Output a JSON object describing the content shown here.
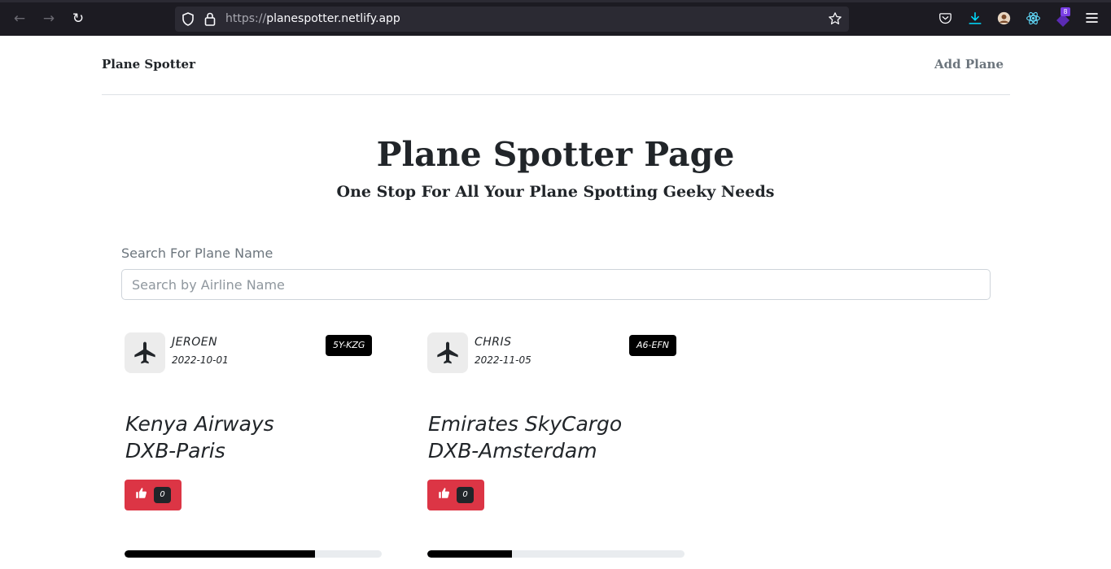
{
  "browser": {
    "url_scheme": "https://",
    "url_host": "planespotter.netlify.app",
    "extension_badge": "8"
  },
  "nav": {
    "brand": "Plane Spotter",
    "add_plane": "Add Plane"
  },
  "hero": {
    "title": "Plane Spotter Page",
    "subtitle": "One Stop For All Your Plane Spotting Geeky Needs"
  },
  "search": {
    "label": "Search For Plane Name",
    "placeholder": "Search by Airline Name",
    "value": ""
  },
  "planes": [
    {
      "spotter": "JEROEN",
      "date": "2022-10-01",
      "registration": "5Y-KZG",
      "airline": "Kenya Airways",
      "route": "DXB-Paris",
      "likes": "0",
      "progress": 0.74
    },
    {
      "spotter": "CHRIS",
      "date": "2022-11-05",
      "registration": "A6-EFN",
      "airline": "Emirates SkyCargo",
      "route": "DXB-Amsterdam",
      "likes": "0",
      "progress": 0.33
    }
  ],
  "icons": {
    "avatar": "airplane-icon",
    "like": "thumbs-up-icon"
  },
  "colors": {
    "like_button": "#dc3545",
    "badge": "#000000",
    "progress_fill": "#000000"
  }
}
